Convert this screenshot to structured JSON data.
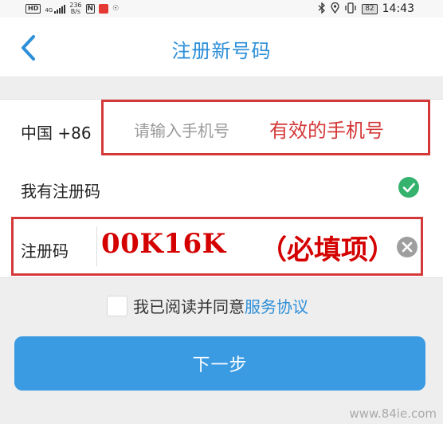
{
  "status_bar": {
    "network_type": "4G",
    "speed_value": "236",
    "speed_unit": "B/s",
    "hd_label": "HD",
    "nfc_label": "N",
    "battery": "82",
    "time": "14:43"
  },
  "header": {
    "title": "注册新号码"
  },
  "phone_row": {
    "country_code": "中国 +86",
    "placeholder": "请输入手机号",
    "annotation": "有效的手机号"
  },
  "has_code_row": {
    "label": "我有注册码",
    "checked": true
  },
  "code_row": {
    "label": "注册码",
    "value": "00K16K",
    "annotation": "（必填项）"
  },
  "agreement": {
    "checked": false,
    "text": "我已阅读并同意",
    "link": "服务协议"
  },
  "next_button": {
    "label": "下一步"
  },
  "watermark": "www.84ie.com",
  "colors": {
    "accent": "#2d8fd8",
    "button": "#3a9be3",
    "annotation_red": "#d43838",
    "check_green": "#35b36e"
  }
}
